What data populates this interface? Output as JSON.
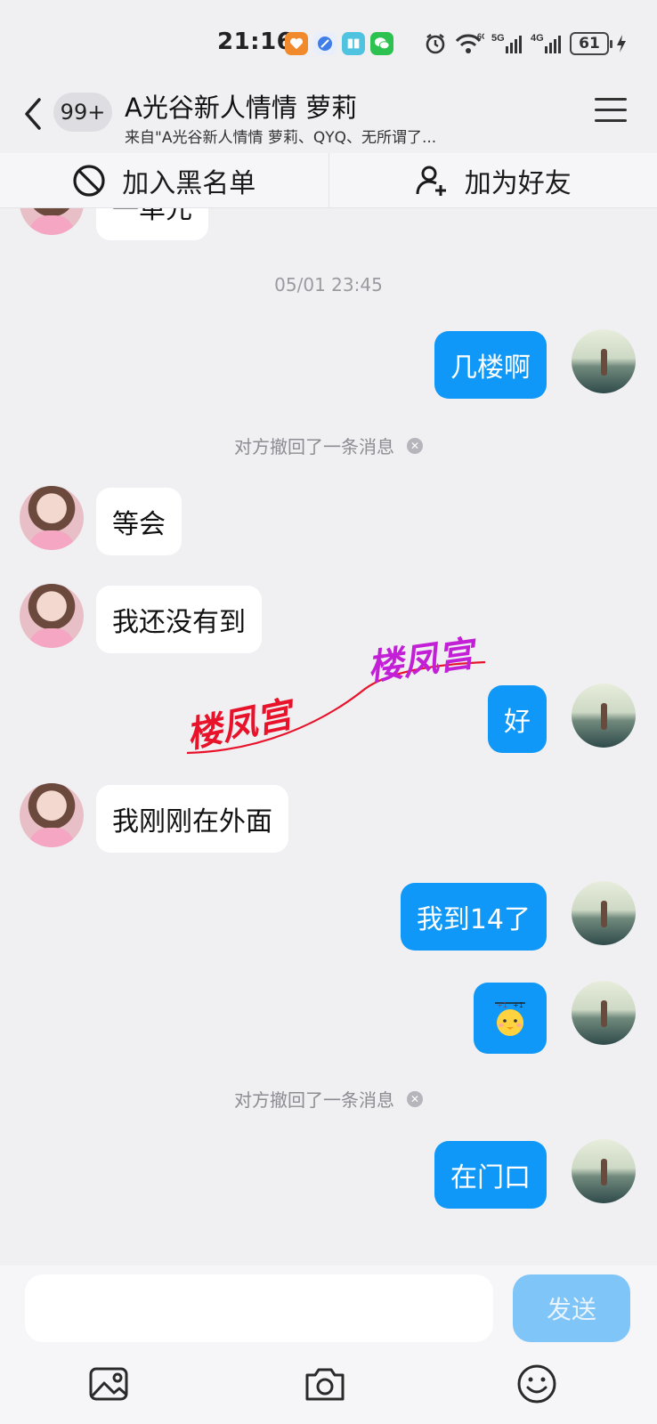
{
  "status_bar": {
    "time": "21:16",
    "network": [
      "6G",
      "5G",
      "4G"
    ],
    "battery": "61"
  },
  "header": {
    "unread_badge": "99+",
    "title": "A光谷新人情情 萝莉",
    "subtitle": "来自\"A光谷新人情情 萝莉、QYQ、无所谓了..."
  },
  "actions": {
    "block_label": "加入黑名单",
    "add_friend_label": "加为好友"
  },
  "chat": {
    "partial_message": "一单元",
    "timestamp": "05/01 23:45",
    "messages": [
      {
        "side": "out",
        "text": "几楼啊"
      },
      {
        "side": "system",
        "text": "对方撤回了一条消息"
      },
      {
        "side": "in",
        "text": "等会"
      },
      {
        "side": "in",
        "text": "我还没有到"
      },
      {
        "side": "out",
        "text": "好"
      },
      {
        "side": "in",
        "text": "我刚刚在外面"
      },
      {
        "side": "out",
        "text": "我到14了"
      },
      {
        "side": "out",
        "text": "sticker"
      },
      {
        "side": "system",
        "text": "对方撤回了一条消息"
      },
      {
        "side": "out",
        "text": "在门口"
      }
    ]
  },
  "watermark": {
    "text_left": "楼凤宫",
    "text_right": "楼凤宫",
    "color_left": "#e8132b",
    "color_right": "#c21fd6"
  },
  "composer": {
    "input_value": "",
    "send_label": "发送"
  },
  "colors": {
    "outgoing_bubble": "#0f98f7",
    "incoming_bubble": "#ffffff",
    "background": "#f0f0f3"
  }
}
